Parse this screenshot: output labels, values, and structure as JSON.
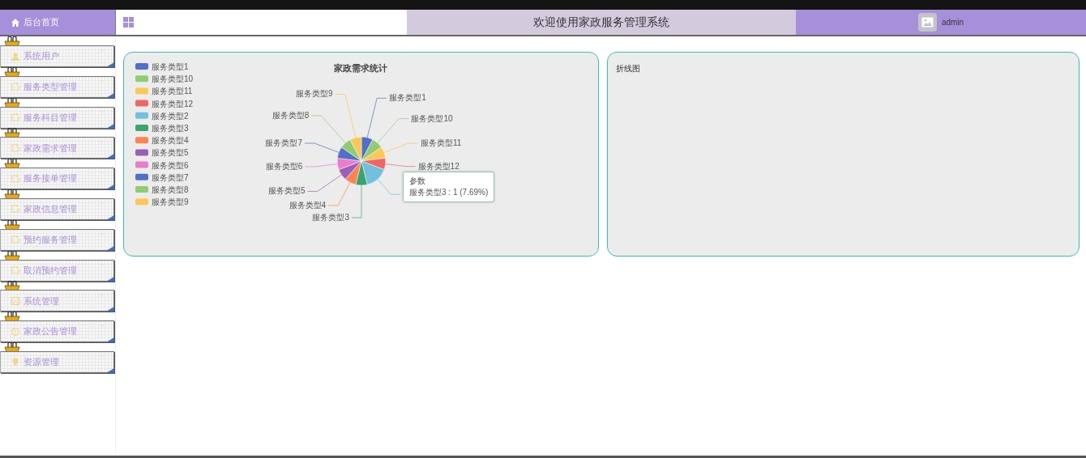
{
  "sidebar": {
    "home": "后台首页",
    "items": [
      {
        "label": "系统用户",
        "kind": "user"
      },
      {
        "label": "服务类型管理",
        "kind": "doc"
      },
      {
        "label": "服务科目管理",
        "kind": "doc"
      },
      {
        "label": "家政需求管理",
        "kind": "doc"
      },
      {
        "label": "服务接单管理",
        "kind": "doc"
      },
      {
        "label": "家政信息管理",
        "kind": "doc"
      },
      {
        "label": "预约服务管理",
        "kind": "doc"
      },
      {
        "label": "取消预约管理",
        "kind": "doc"
      },
      {
        "label": "系统管理",
        "kind": "image"
      },
      {
        "label": "家政公告管理",
        "kind": "info"
      },
      {
        "label": "资源管理",
        "kind": "bulb"
      }
    ]
  },
  "header": {
    "title": "欢迎使用家政服务管理系统",
    "user": "admin"
  },
  "panels": [
    {
      "kind": "pie",
      "chart_data": {
        "type": "pie",
        "title": "家政需求统计",
        "legend": "left",
        "categories": [
          "服务类型1",
          "服务类型10",
          "服务类型11",
          "服务类型12",
          "服务类型2",
          "服务类型3",
          "服务类型4",
          "服务类型5",
          "服务类型6",
          "服务类型7",
          "服务类型8",
          "服务类型9"
        ],
        "series": [
          {
            "name": "参数",
            "values": [
              1,
              1,
              1,
              1,
              2,
              1,
              1,
              1,
              1,
              1,
              1,
              1
            ]
          }
        ],
        "annotations": [
          "服务类型3 : 1 (7.69%)"
        ]
      }
    },
    {
      "kind": "empty",
      "title": "折线图"
    }
  ]
}
